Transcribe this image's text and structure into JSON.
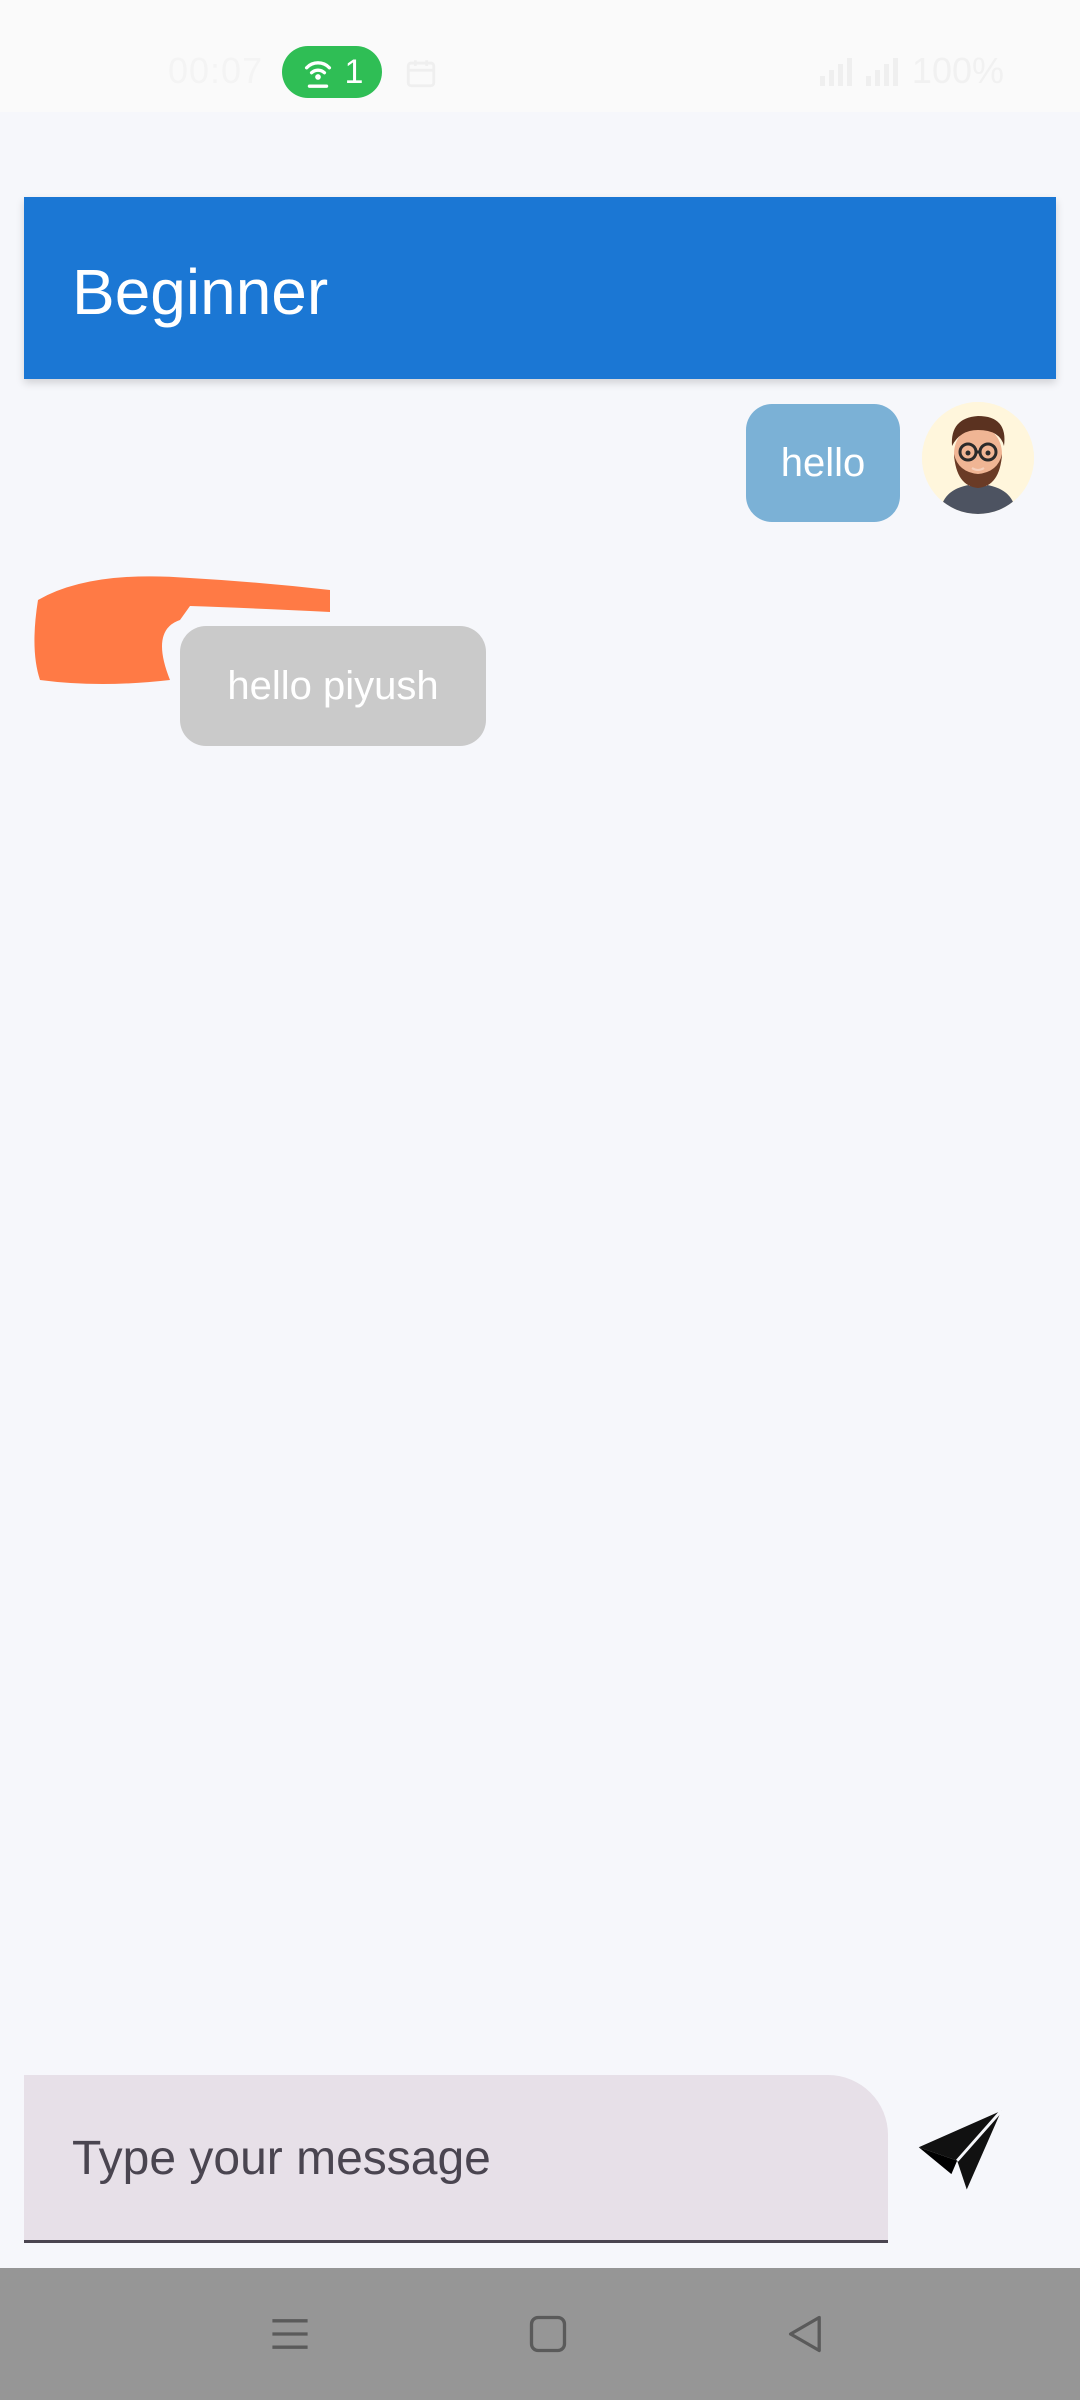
{
  "status_bar": {
    "time": "00:07",
    "hotspot_count": "1",
    "battery": "100%"
  },
  "header": {
    "title": "Beginner",
    "background": "#1b77d4"
  },
  "messages": [
    {
      "direction": "sent",
      "text": "hello",
      "bubble_color": "#7bb1d6"
    },
    {
      "direction": "received",
      "text": "hello piyush",
      "bubble_color": "#cacaca"
    }
  ],
  "composer": {
    "placeholder": "Type your message",
    "value": ""
  },
  "icons": {
    "send": "send-icon",
    "avatar": "user-avatar",
    "nav_menu": "menu-icon",
    "nav_home": "home-icon",
    "nav_back": "back-icon"
  }
}
